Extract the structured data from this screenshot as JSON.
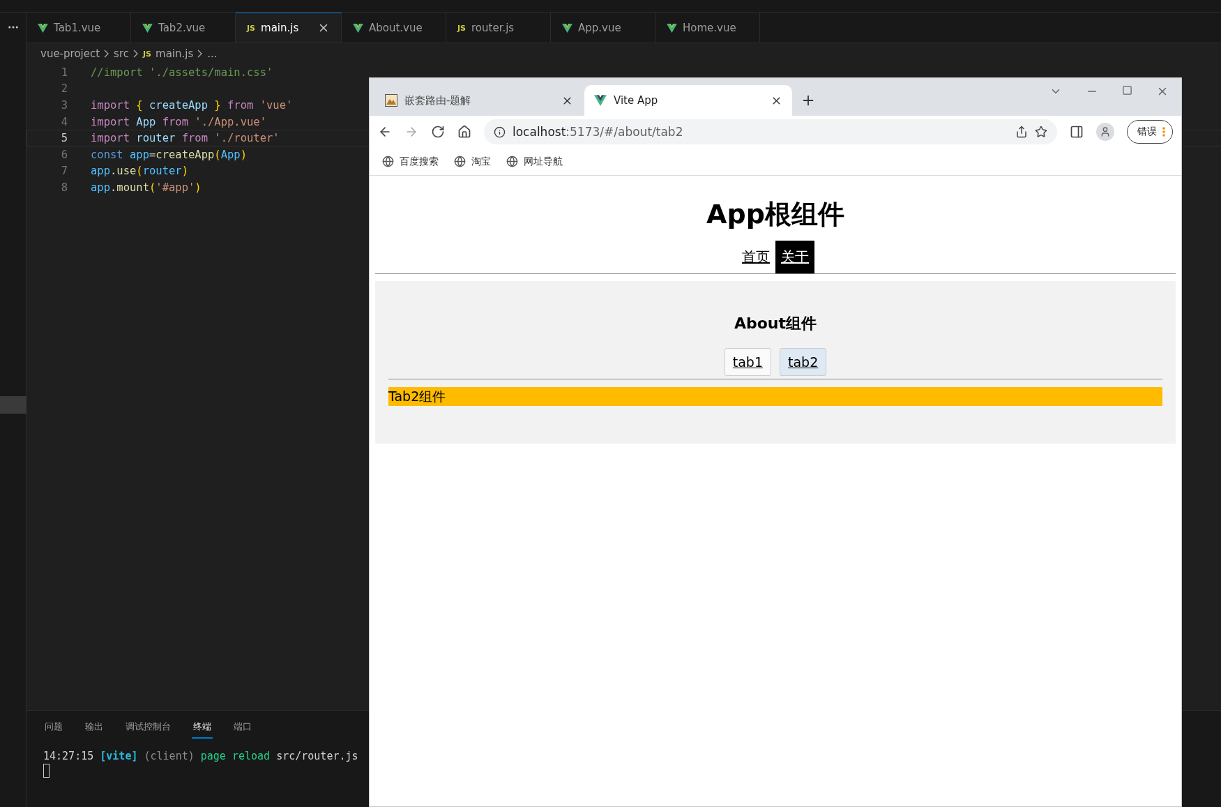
{
  "editor": {
    "tabs": [
      {
        "label": "Tab1.vue",
        "kind": "vue",
        "selected": false
      },
      {
        "label": "Tab2.vue",
        "kind": "vue",
        "selected": false
      },
      {
        "label": "main.js",
        "kind": "js",
        "icon_text": "JS",
        "selected": true
      },
      {
        "label": "About.vue",
        "kind": "vue",
        "selected": false
      },
      {
        "label": "router.js",
        "kind": "js",
        "icon_text": "JS",
        "selected": false
      },
      {
        "label": "App.vue",
        "kind": "vue",
        "selected": false
      },
      {
        "label": "Home.vue",
        "kind": "vue",
        "selected": false
      }
    ],
    "breadcrumb": [
      {
        "label": "vue-project"
      },
      {
        "label": "src"
      },
      {
        "label": "main.js",
        "icon_text": "JS"
      },
      {
        "label": "..."
      }
    ],
    "code_lines": [
      {
        "number": "1",
        "current": false,
        "tokens": [
          {
            "text": "//import './assets/main.css'",
            "kind": "comment"
          }
        ]
      },
      {
        "number": "2",
        "current": false
      },
      {
        "number": "3",
        "current": false,
        "tokens": [
          {
            "text": "import",
            "kind": "keyword"
          },
          {
            "text": " {",
            "kind": "bracket"
          },
          {
            "text": " createApp ",
            "kind": "variable"
          },
          {
            "text": "}",
            "kind": "bracket"
          },
          {
            "text": " from ",
            "kind": "keyword"
          },
          {
            "text": "'vue'",
            "kind": "string"
          }
        ]
      },
      {
        "number": "4",
        "current": false,
        "tokens": [
          {
            "text": "import",
            "kind": "keyword"
          },
          {
            "text": " App ",
            "kind": "variable"
          },
          {
            "text": "from",
            "kind": "keyword"
          },
          {
            "text": " './App.vue'",
            "kind": "string"
          }
        ]
      },
      {
        "number": "5",
        "current": true,
        "tokens": [
          {
            "text": "import",
            "kind": "keyword"
          },
          {
            "text": " router ",
            "kind": "variable"
          },
          {
            "text": "from",
            "kind": "keyword"
          },
          {
            "text": " './router'",
            "kind": "string"
          }
        ]
      },
      {
        "number": "6",
        "current": false,
        "tokens": [
          {
            "text": "const",
            "kind": "storage"
          },
          {
            "text": " app",
            "kind": "constant"
          },
          {
            "text": "=",
            "kind": "plain"
          },
          {
            "text": "createApp",
            "kind": "function"
          },
          {
            "text": "(",
            "kind": "bracket"
          },
          {
            "text": "App",
            "kind": "constant"
          },
          {
            "text": ")",
            "kind": "bracket"
          }
        ]
      },
      {
        "number": "7",
        "current": false,
        "tokens": [
          {
            "text": "app",
            "kind": "constant"
          },
          {
            "text": ".",
            "kind": "plain"
          },
          {
            "text": "use",
            "kind": "function"
          },
          {
            "text": "(",
            "kind": "bracket"
          },
          {
            "text": "router",
            "kind": "constant"
          },
          {
            "text": ")",
            "kind": "bracket"
          }
        ]
      },
      {
        "number": "8",
        "current": false,
        "tokens": [
          {
            "text": "app",
            "kind": "constant"
          },
          {
            "text": ".",
            "kind": "plain"
          },
          {
            "text": "mount",
            "kind": "function"
          },
          {
            "text": "(",
            "kind": "bracket"
          },
          {
            "text": "'#app'",
            "kind": "string"
          },
          {
            "text": ")",
            "kind": "bracket"
          }
        ]
      }
    ],
    "panel_tabs": [
      {
        "label": "问题",
        "selected": false
      },
      {
        "label": "输出",
        "selected": false
      },
      {
        "label": "调试控制台",
        "selected": false
      },
      {
        "label": "终端",
        "selected": true
      },
      {
        "label": "端口",
        "selected": false
      }
    ],
    "terminal_line": [
      {
        "text": "14:27:15 ",
        "kind": "plain"
      },
      {
        "text": "[vite]",
        "kind": "tag"
      },
      {
        "text": " (client)",
        "kind": "dim"
      },
      {
        "text": " page reload",
        "kind": "success"
      },
      {
        "text": " src/router.js",
        "kind": "plain"
      }
    ]
  },
  "browser": {
    "tabs": [
      {
        "title": "嵌套路由-题解",
        "kind": "picture",
        "selected": false
      },
      {
        "title": "Vite App",
        "kind": "vite",
        "selected": true
      }
    ],
    "address": {
      "host": "localhost",
      "rest": ":5173/#/about/tab2"
    },
    "error_button": "错误",
    "bookmarks": [
      "百度搜索",
      "淘宝",
      "网址导航"
    ],
    "page": {
      "title": "App根组件",
      "nav": [
        {
          "label": "首页",
          "selected": false
        },
        {
          "label": "关于",
          "selected": true
        }
      ],
      "about": {
        "heading": "About组件",
        "tabs": [
          {
            "label": "tab1",
            "selected": false
          },
          {
            "label": "tab2",
            "selected": true
          }
        ],
        "content": "Tab2组件"
      }
    }
  }
}
